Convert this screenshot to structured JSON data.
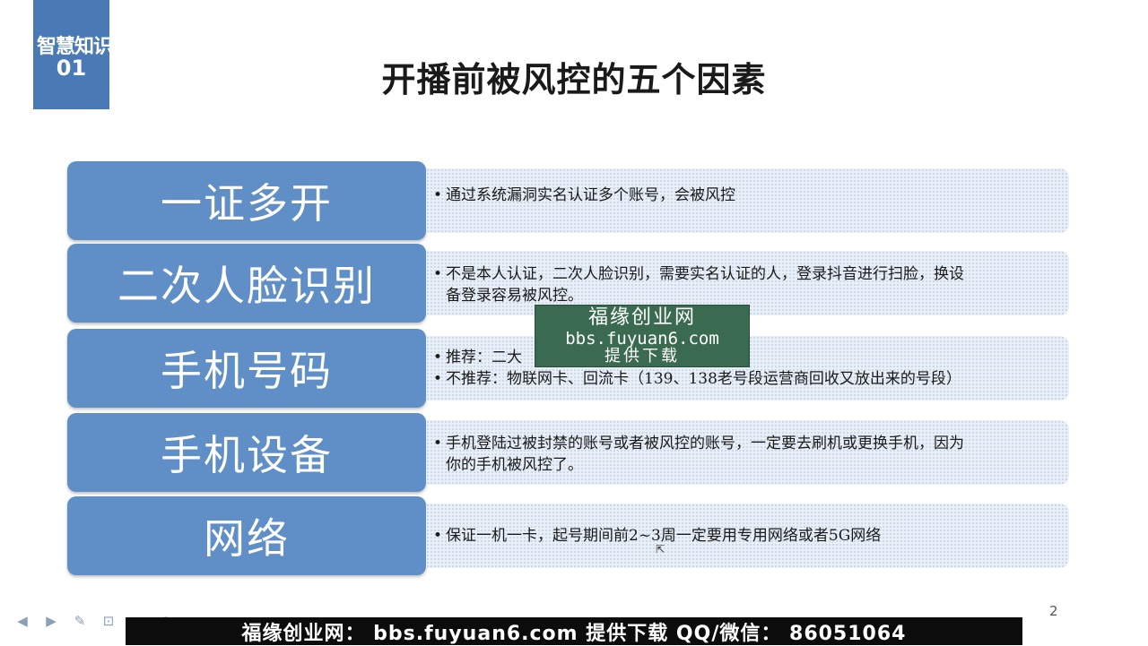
{
  "corner_badge": {
    "line1": "智慧知识",
    "line2": "01"
  },
  "slide": {
    "title": "开播前被风控的五个因素",
    "page_number": "2"
  },
  "rows": [
    {
      "label": "一证多开",
      "bullet": "•",
      "lines": [
        "通过系统漏洞实名认证多个账号，会被风控"
      ]
    },
    {
      "label": "二次人脸识别",
      "bullet": "•",
      "lines": [
        "不是本人认证，二次人脸识别，需要实名认证的人，登录抖音进行扫脸，换设",
        "备登录容易被风控。"
      ]
    },
    {
      "label": "手机号码",
      "bullet": "•",
      "lines": [
        "推荐：二大",
        "不推荐：物联网卡、回流卡（139、138老号段运营商回收又放出来的号段）"
      ]
    },
    {
      "label": "手机设备",
      "bullet": "•",
      "lines": [
        "手机登陆过被封禁的账号或者被风控的账号，一定要去刷机或更换手机，因为",
        "你的手机被风控了。"
      ]
    },
    {
      "label": "网络",
      "bullet": "•",
      "lines": [
        "保证一机一卡，起号期间前2~3周一定要用专用网络或者5G网络"
      ]
    }
  ],
  "watermark": {
    "line1": "福缘创业网",
    "line2": "bbs.fuyuan6.com",
    "line3": "提供下载"
  },
  "banner": {
    "text": "福缘创业网：  bbs.fuyuan6.com  提供下载   QQ/微信：  86051064"
  },
  "toolbar": {
    "icons": [
      "prev-icon",
      "next-icon",
      "pen-icon",
      "zoom-icon",
      "menu-icon",
      "pointer-icon"
    ],
    "glyphs": [
      "◀",
      "▶",
      "✎",
      "⊡",
      "▭",
      "●"
    ]
  },
  "colors": {
    "accent": "#5f8fc6",
    "badge": "#4a7ab5",
    "desc_bg": "#e9eff7",
    "watermark_bg": "#3a6a4f",
    "banner_bg": "#0c0c0c"
  }
}
